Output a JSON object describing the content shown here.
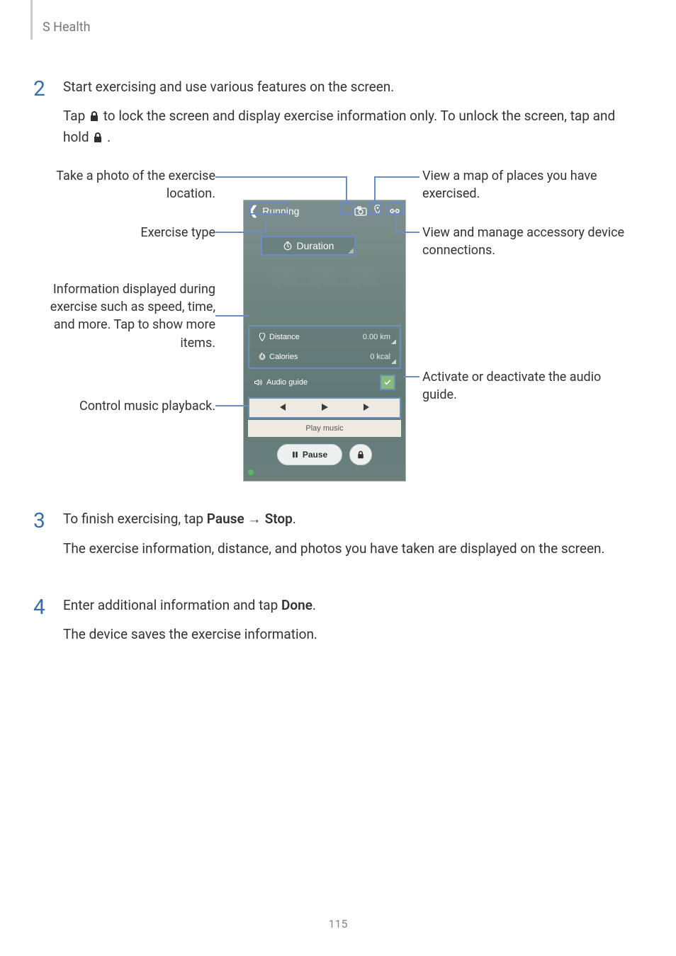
{
  "header": {
    "title": "S Health"
  },
  "steps": {
    "s2": {
      "num": "2",
      "line1": "Start exercising and use various features on the screen.",
      "line2a": "Tap ",
      "line2b": " to lock the screen and display exercise information only. To unlock the screen, tap and hold ",
      "line2c": "."
    },
    "s3": {
      "num": "3",
      "line1a": "To finish exercising, tap ",
      "btn1": "Pause",
      "arrow": " → ",
      "btn2": "Stop",
      "line1b": ".",
      "line2": "The exercise information, distance, and photos you have taken are displayed on the screen."
    },
    "s4": {
      "num": "4",
      "line1a": "Enter additional information and tap ",
      "btn": "Done",
      "line1b": ".",
      "line2": "The device saves the exercise information."
    }
  },
  "diagram": {
    "topbar_title": "Running",
    "duration_label": "Duration",
    "distance_label": "Distance",
    "distance_value": "0.00 km",
    "calories_label": "Calories",
    "calories_value": "0 kcal",
    "audio_label": "Audio guide",
    "play_music": "Play music",
    "pause_label": "Pause",
    "callouts": {
      "photo": "Take a photo of the exercise location.",
      "exercise": "Exercise type",
      "info": "Information displayed during exercise such as speed, time, and more. Tap to show more items.",
      "playback": "Control music playback.",
      "map": "View a map of places you have exercised.",
      "accessory": "View and manage accessory device connections.",
      "audio": "Activate or deactivate the audio guide."
    }
  },
  "page_number": "115"
}
